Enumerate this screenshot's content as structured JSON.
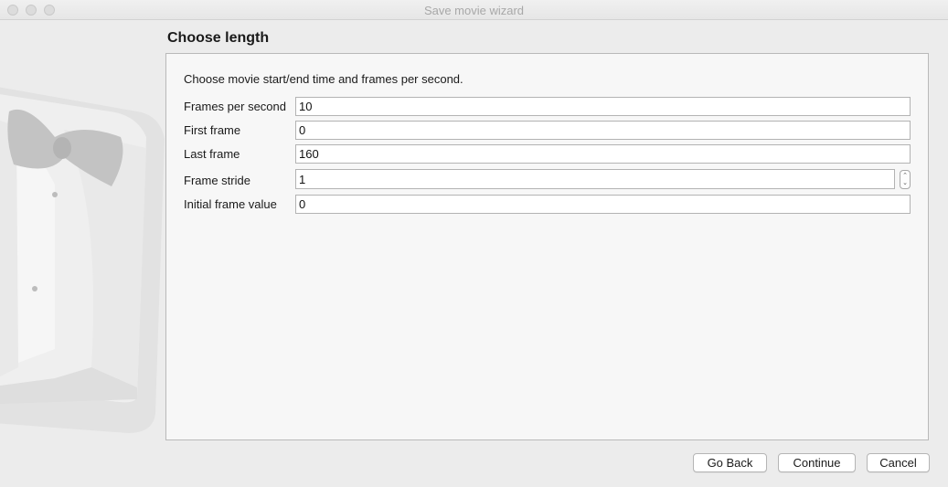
{
  "window": {
    "title": "Save movie wizard"
  },
  "page": {
    "title": "Choose length",
    "instructions": "Choose movie start/end time and frames per second."
  },
  "fields": {
    "fps": {
      "label": "Frames per second",
      "value": "10"
    },
    "first_frame": {
      "label": "First frame",
      "value": "0"
    },
    "last_frame": {
      "label": "Last frame",
      "value": "160"
    },
    "frame_stride": {
      "label": "Frame stride",
      "value": "1"
    },
    "initial_frame_value": {
      "label": "Initial frame value",
      "value": "0"
    }
  },
  "buttons": {
    "go_back": "Go Back",
    "continue": "Continue",
    "cancel": "Cancel"
  },
  "icons": {
    "stepper_up": "⌃",
    "stepper_down": "⌄"
  }
}
